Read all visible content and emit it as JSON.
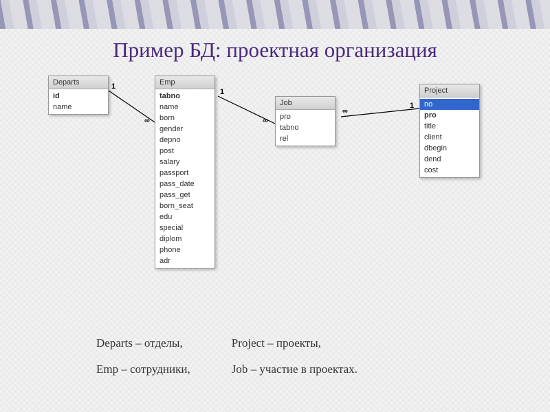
{
  "title": "Пример БД: проектная организация",
  "tables": {
    "departs": {
      "name": "Departs",
      "fields": [
        {
          "label": "id",
          "bold": true
        },
        {
          "label": "name"
        }
      ]
    },
    "emp": {
      "name": "Emp",
      "fields": [
        {
          "label": "tabno",
          "bold": true
        },
        {
          "label": "name"
        },
        {
          "label": "born"
        },
        {
          "label": "gender"
        },
        {
          "label": "depno"
        },
        {
          "label": "post"
        },
        {
          "label": "salary"
        },
        {
          "label": "passport"
        },
        {
          "label": "pass_date"
        },
        {
          "label": "pass_get"
        },
        {
          "label": "born_seat"
        },
        {
          "label": "edu"
        },
        {
          "label": "special"
        },
        {
          "label": "diplom"
        },
        {
          "label": "phone"
        },
        {
          "label": "adr"
        }
      ]
    },
    "job": {
      "name": "Job",
      "fields": [
        {
          "label": "pro"
        },
        {
          "label": "tabno"
        },
        {
          "label": "rel"
        }
      ]
    },
    "project": {
      "name": "Project",
      "fields": [
        {
          "label": "no",
          "selected": true
        },
        {
          "label": "pro",
          "bold": true
        },
        {
          "label": "title"
        },
        {
          "label": "client"
        },
        {
          "label": "dbegin"
        },
        {
          "label": "dend"
        },
        {
          "label": "cost"
        }
      ]
    }
  },
  "relationships": {
    "departs_emp": {
      "left": "1",
      "right": "∞"
    },
    "emp_job": {
      "left": "1",
      "right": "∞"
    },
    "job_project": {
      "left": "∞",
      "right": "1"
    }
  },
  "legend": {
    "departs": "Departs – отделы,",
    "emp": "Emp – сотрудники,",
    "project": "Project – проекты,",
    "job": "Job – участие в проектах."
  }
}
